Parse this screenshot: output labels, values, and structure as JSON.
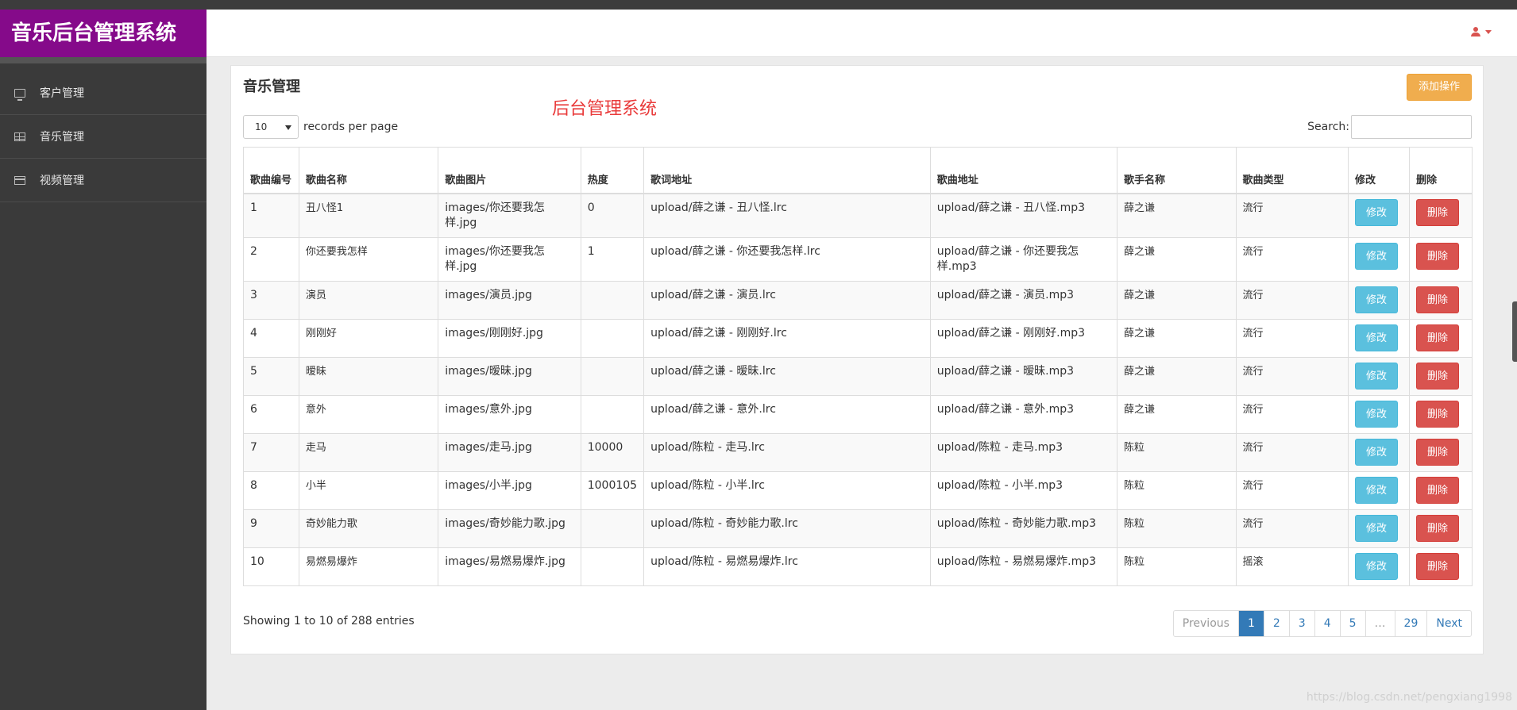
{
  "app": {
    "brand": "音乐后台管理系统"
  },
  "sidebar": {
    "items": [
      {
        "label": "客户管理",
        "icon": "monitor-icon"
      },
      {
        "label": "音乐管理",
        "icon": "table-icon"
      },
      {
        "label": "视频管理",
        "icon": "card-icon"
      }
    ]
  },
  "header": {
    "user_icon": "user-icon"
  },
  "panel": {
    "title": "音乐管理",
    "overlay_title": "后台管理系统",
    "add_button": "添加操作",
    "length_value": "10",
    "length_suffix": "records per page",
    "search_label": "Search:",
    "search_value": ""
  },
  "table": {
    "headers": [
      "歌曲编号",
      "歌曲名称",
      "歌曲图片",
      "热度",
      "歌词地址",
      "歌曲地址",
      "歌手名称",
      "歌曲类型",
      "修改",
      "删除"
    ],
    "edit_label": "修改",
    "delete_label": "删除",
    "rows": [
      {
        "id": "1",
        "name": "丑八怪1",
        "image": "images/你还要我怎样.jpg",
        "heat": "0",
        "lyric": "upload/薛之谦 - 丑八怪.lrc",
        "song": "upload/薛之谦 - 丑八怪.mp3",
        "singer": "薛之谦",
        "type": "流行"
      },
      {
        "id": "2",
        "name": "你还要我怎样",
        "image": "images/你还要我怎样.jpg",
        "heat": "1",
        "lyric": "upload/薛之谦 - 你还要我怎样.lrc",
        "song": "upload/薛之谦 - 你还要我怎样.mp3",
        "singer": "薛之谦",
        "type": "流行"
      },
      {
        "id": "3",
        "name": "演员",
        "image": "images/演员.jpg",
        "heat": "",
        "lyric": "upload/薛之谦 - 演员.lrc",
        "song": "upload/薛之谦 - 演员.mp3",
        "singer": "薛之谦",
        "type": "流行"
      },
      {
        "id": "4",
        "name": "刚刚好",
        "image": "images/刚刚好.jpg",
        "heat": "",
        "lyric": "upload/薛之谦 - 刚刚好.lrc",
        "song": "upload/薛之谦 - 刚刚好.mp3",
        "singer": "薛之谦",
        "type": "流行"
      },
      {
        "id": "5",
        "name": "暧昧",
        "image": "images/暧昧.jpg",
        "heat": "",
        "lyric": "upload/薛之谦 - 暧昧.lrc",
        "song": "upload/薛之谦 - 暧昧.mp3",
        "singer": "薛之谦",
        "type": "流行"
      },
      {
        "id": "6",
        "name": "意外",
        "image": "images/意外.jpg",
        "heat": "",
        "lyric": "upload/薛之谦 - 意外.lrc",
        "song": "upload/薛之谦 - 意外.mp3",
        "singer": "薛之谦",
        "type": "流行"
      },
      {
        "id": "7",
        "name": "走马",
        "image": "images/走马.jpg",
        "heat": "10000",
        "lyric": "upload/陈粒 - 走马.lrc",
        "song": "upload/陈粒 - 走马.mp3",
        "singer": "陈粒",
        "type": "流行"
      },
      {
        "id": "8",
        "name": "小半",
        "image": "images/小半.jpg",
        "heat": "1000105",
        "lyric": "upload/陈粒 - 小半.lrc",
        "song": "upload/陈粒 - 小半.mp3",
        "singer": "陈粒",
        "type": "流行"
      },
      {
        "id": "9",
        "name": "奇妙能力歌",
        "image": "images/奇妙能力歌.jpg",
        "heat": "",
        "lyric": "upload/陈粒 - 奇妙能力歌.lrc",
        "song": "upload/陈粒 - 奇妙能力歌.mp3",
        "singer": "陈粒",
        "type": "流行"
      },
      {
        "id": "10",
        "name": "易燃易爆炸",
        "image": "images/易燃易爆炸.jpg",
        "heat": "",
        "lyric": "upload/陈粒 - 易燃易爆炸.lrc",
        "song": "upload/陈粒 - 易燃易爆炸.mp3",
        "singer": "陈粒",
        "type": "摇滚"
      }
    ]
  },
  "footer": {
    "info": "Showing 1 to 10 of 288 entries",
    "pagination": [
      "Previous",
      "1",
      "2",
      "3",
      "4",
      "5",
      "…",
      "29",
      "Next"
    ],
    "active_page": "1",
    "watermark": "https://blog.csdn.net/pengxiang1998"
  },
  "colors": {
    "brand_bg": "#850a8a",
    "sidebar_bg": "#3a3a3a",
    "add_button": "#f0ad4e",
    "edit_button": "#5bc0de",
    "delete_button": "#d9534f",
    "overlay_title": "#e93b3b",
    "page_active": "#337ab7"
  }
}
